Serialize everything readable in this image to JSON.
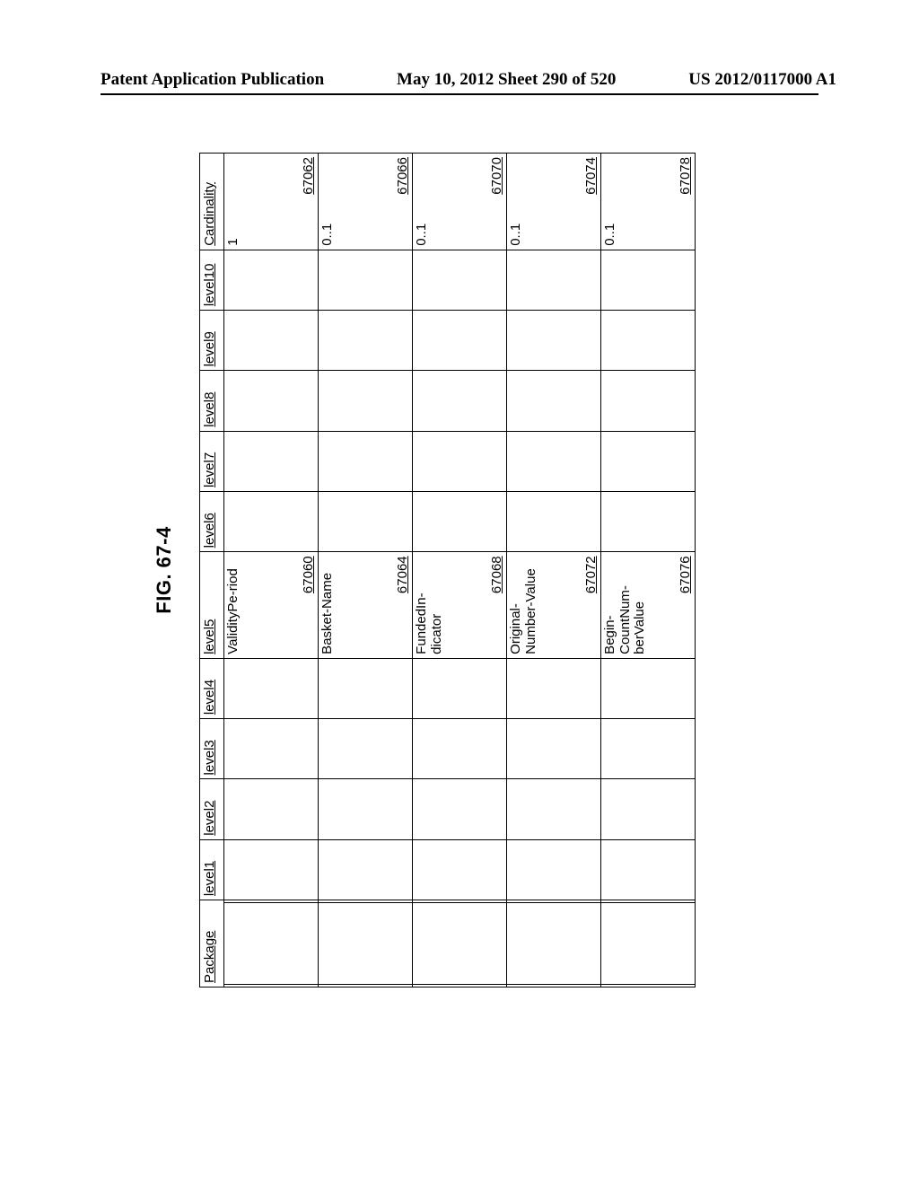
{
  "header": {
    "left": "Patent Application Publication",
    "center": "May 10, 2012  Sheet 290 of 520",
    "right": "US 2012/0117000 A1"
  },
  "figure_label": "FIG. 67-4",
  "columns": {
    "package": "Package",
    "level1": "level1",
    "level2": "level2",
    "level3": "level3",
    "level4": "level4",
    "level5": "level5",
    "level6": "level6",
    "level7": "level7",
    "level8": "level8",
    "level9": "level9",
    "level10": "level10",
    "cardinality": "Cardinality"
  },
  "rows": [
    {
      "level5_text": "ValidityPe-riod",
      "level5_ref": "67060",
      "cardinality_value": "1",
      "cardinality_ref": "67062"
    },
    {
      "level5_text": "Basket-Name",
      "level5_ref": "67064",
      "cardinality_value": "0..1",
      "cardinality_ref": "67066"
    },
    {
      "level5_text": "FundedIn-dicator",
      "level5_ref": "67068",
      "cardinality_value": "0..1",
      "cardinality_ref": "67070"
    },
    {
      "level5_text": "Original-Number-Value",
      "level5_ref": "67072",
      "cardinality_value": "0..1",
      "cardinality_ref": "67074"
    },
    {
      "level5_text": "Begin-CountNum-berValue",
      "level5_ref": "67076",
      "cardinality_value": "0..1",
      "cardinality_ref": "67078"
    }
  ]
}
